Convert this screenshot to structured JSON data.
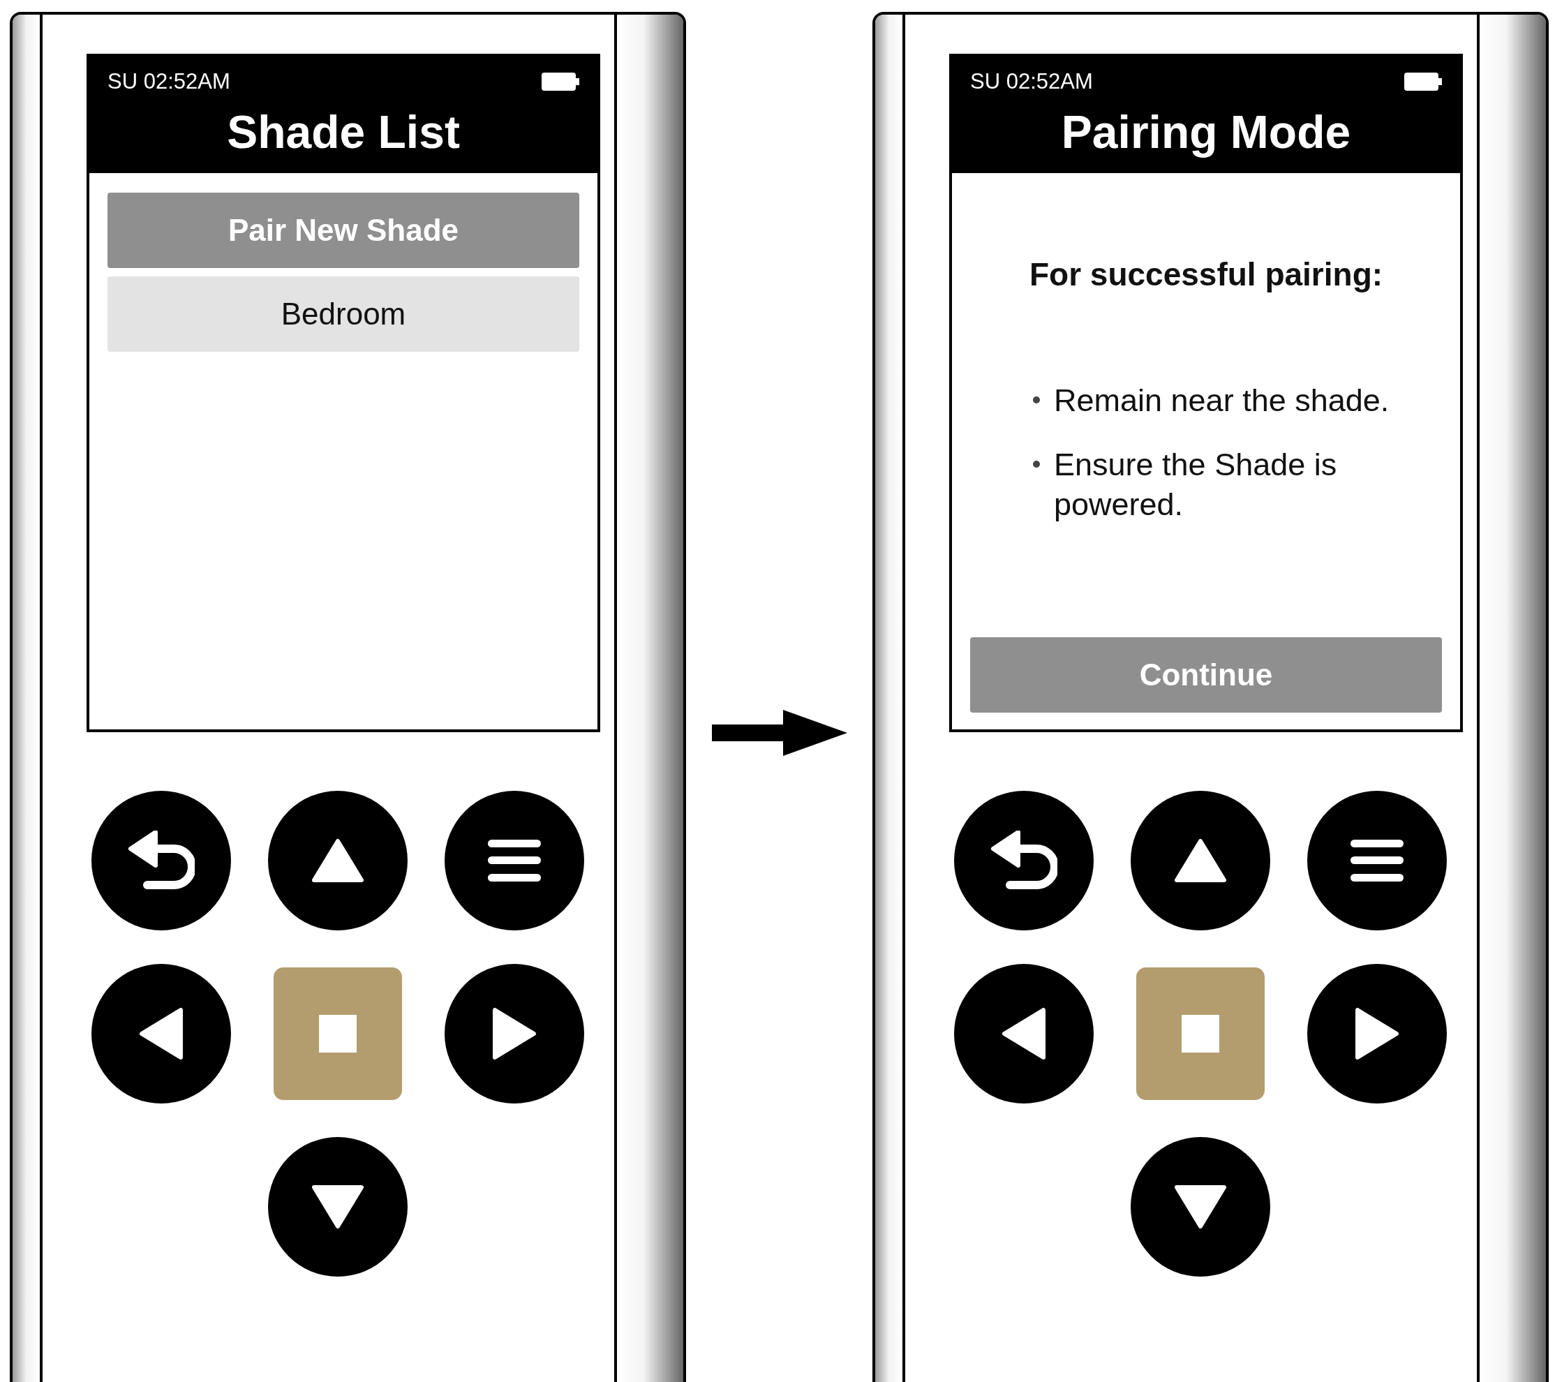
{
  "remotes": [
    {
      "status_time": "SU 02:52AM",
      "title": "Shade List",
      "kind": "list",
      "items": [
        {
          "label": "Pair New Shade",
          "selected": true
        },
        {
          "label": "Bedroom",
          "selected": false
        }
      ]
    },
    {
      "status_time": "SU 02:52AM",
      "title": "Pairing Mode",
      "kind": "info",
      "heading": "For successful pairing:",
      "bullets": [
        "Remain near the shade.",
        "Ensure the Shade is powered."
      ],
      "button": "Continue"
    }
  ]
}
